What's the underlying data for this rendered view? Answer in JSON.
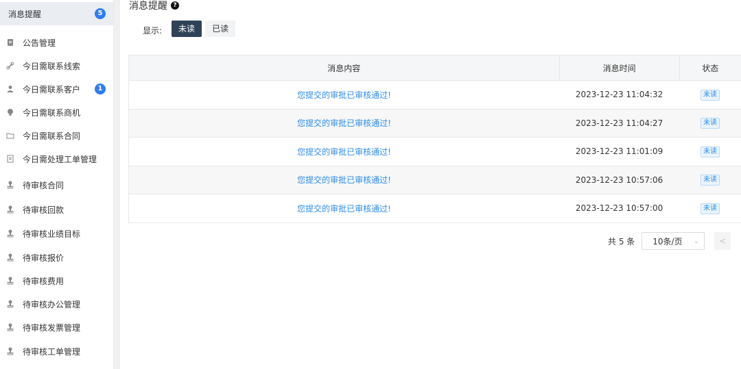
{
  "sidebar": {
    "items": [
      {
        "label": "消息提醒",
        "icon": "",
        "badge": "5"
      },
      {
        "label": "公告管理",
        "icon": "notice-icon",
        "badge": ""
      },
      {
        "label": "今日需联系线索",
        "icon": "link-icon",
        "badge": ""
      },
      {
        "label": "今日需联系客户",
        "icon": "person-icon",
        "badge": "1"
      },
      {
        "label": "今日需联系商机",
        "icon": "bulb-icon",
        "badge": ""
      },
      {
        "label": "今日需联系合同",
        "icon": "folder-icon",
        "badge": ""
      },
      {
        "label": "今日需处理工单管理",
        "icon": "document-icon",
        "badge": ""
      },
      {
        "label": "待审核合同",
        "icon": "stamp-icon",
        "badge": ""
      },
      {
        "label": "待审核回款",
        "icon": "stamp-icon",
        "badge": ""
      },
      {
        "label": "待审核业绩目标",
        "icon": "stamp-icon",
        "badge": ""
      },
      {
        "label": "待审核报价",
        "icon": "stamp-icon",
        "badge": ""
      },
      {
        "label": "待审核费用",
        "icon": "stamp-icon",
        "badge": ""
      },
      {
        "label": "待审核办公管理",
        "icon": "stamp-icon",
        "badge": ""
      },
      {
        "label": "待审核发票管理",
        "icon": "stamp-icon",
        "badge": ""
      },
      {
        "label": "待审核工单管理",
        "icon": "stamp-icon",
        "badge": ""
      }
    ]
  },
  "header": {
    "title": "消息提醒",
    "help_icon": "question-icon"
  },
  "filter": {
    "label": "显示:",
    "unread": "未读",
    "read": "已读",
    "selected": "未读"
  },
  "table": {
    "columns": [
      "消息内容",
      "消息时间",
      "状态"
    ],
    "rows": [
      {
        "content": "您提交的审批已审核通过!",
        "time": "2023-12-23 11:04:32",
        "status": "未读"
      },
      {
        "content": "您提交的审批已审核通过!",
        "time": "2023-12-23 11:04:27",
        "status": "未读"
      },
      {
        "content": "您提交的审批已审核通过!",
        "time": "2023-12-23 11:01:09",
        "status": "未读"
      },
      {
        "content": "您提交的审批已审核通过!",
        "time": "2023-12-23 10:57:06",
        "status": "未读"
      },
      {
        "content": "您提交的审批已审核通过!",
        "time": "2023-12-23 10:57:00",
        "status": "未读"
      }
    ]
  },
  "pagination": {
    "total": "共 5 条",
    "page_size": "10条/页",
    "prev": "<"
  },
  "colors": {
    "accent": "#2f4258",
    "link": "#2e8de6",
    "badge": "#2e7cf6"
  }
}
